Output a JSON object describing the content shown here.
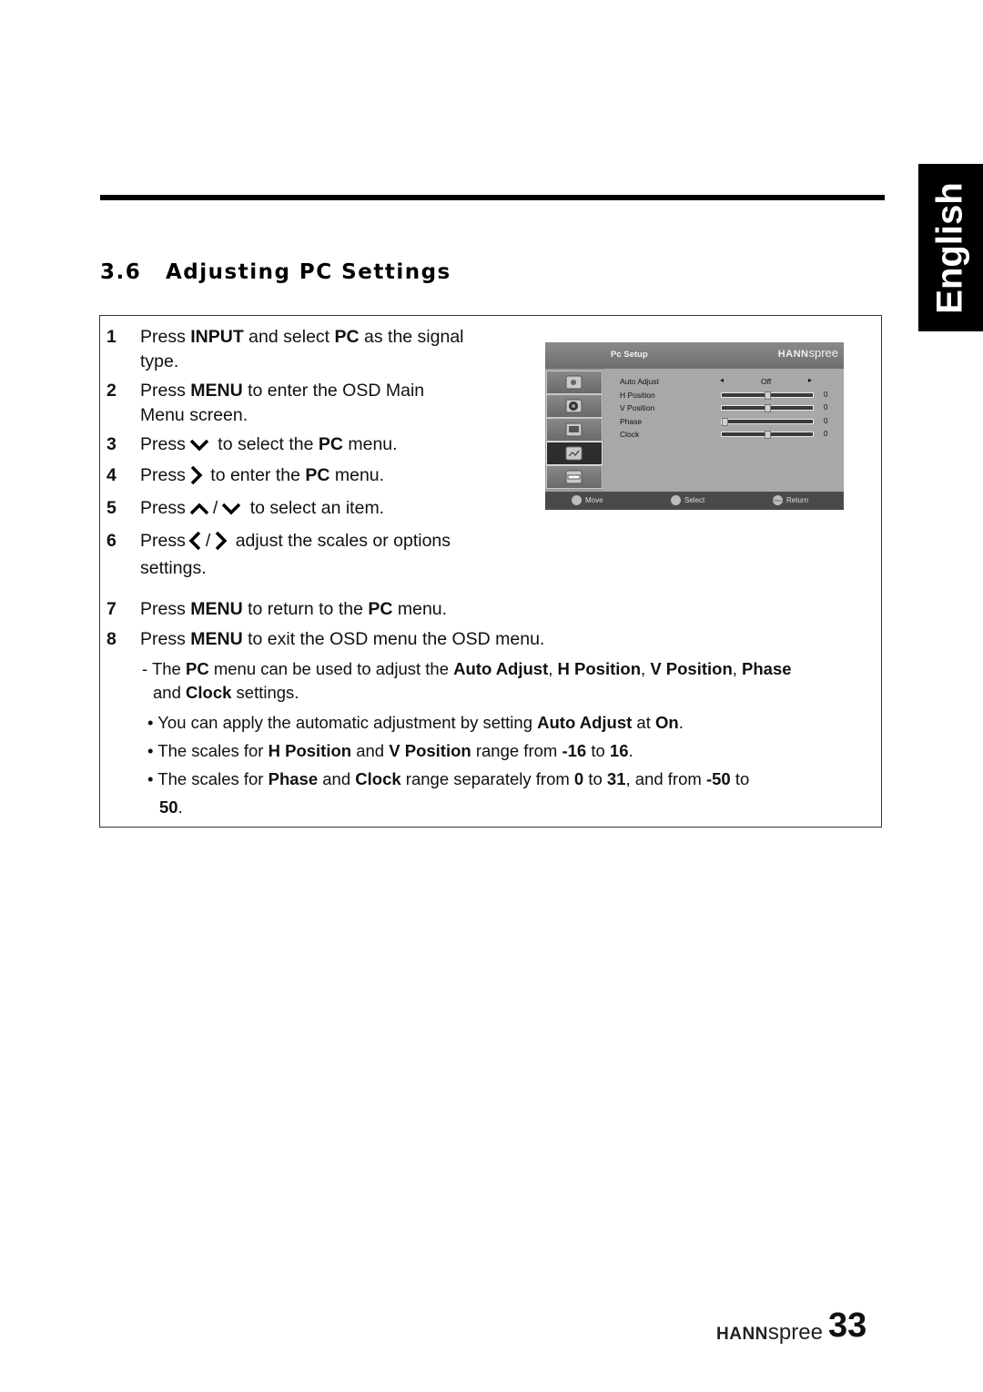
{
  "language_tab": "English",
  "section": {
    "number": "3.6",
    "title": "Adjusting PC Settings"
  },
  "steps": [
    {
      "n": "1",
      "parts": [
        "Press ",
        "INPUT",
        " and select ",
        "PC",
        " as the signal"
      ],
      "line2": "type."
    },
    {
      "n": "2",
      "parts": [
        "Press ",
        "MENU",
        " to enter the OSD Main"
      ],
      "line2": "Menu screen."
    },
    {
      "n": "3",
      "pre": "Press",
      "icon": "down-arrow",
      "post": " to select the ",
      "bold": "PC",
      "end": " menu."
    },
    {
      "n": "4",
      "pre": "Press",
      "icon": "right-arrow",
      "post": " to enter the ",
      "bold": "PC",
      "end": " menu."
    },
    {
      "n": "5",
      "pre": "Press",
      "icon1": "up-arrow",
      "sep": "/",
      "icon2": "down-arrow",
      "post": " to select an item."
    },
    {
      "n": "6",
      "pre": "Press",
      "icon1": "left-arrow",
      "sep": "/",
      "icon2": "right-arrow",
      "post": " adjust the scales or options",
      "line2": "settings."
    },
    {
      "n": "7",
      "parts": [
        "Press ",
        "MENU",
        " to return to the ",
        "PC",
        " menu."
      ]
    },
    {
      "n": "8",
      "parts": [
        "Press ",
        "MENU",
        " to exit the OSD menu the OSD menu."
      ]
    }
  ],
  "notes": {
    "dash": {
      "line1": [
        "- The ",
        "PC",
        " menu can be used to adjust the ",
        "Auto Adjust",
        ", ",
        "H Position",
        ", ",
        "V Position",
        ", ",
        "Phase"
      ],
      "line2": [
        "and ",
        "Clock",
        " settings."
      ]
    },
    "bullets": [
      [
        "• You can apply the automatic adjustment by setting ",
        "Auto Adjust",
        " at ",
        "On",
        "."
      ],
      [
        "• The scales for ",
        "H Position",
        " and ",
        "V Position",
        " range from ",
        "-16",
        " to ",
        "16",
        "."
      ],
      [
        "• The scales for ",
        "Phase",
        " and ",
        "Clock",
        " range separately from ",
        "0",
        " to ",
        "31",
        ", and from ",
        "-50",
        " to"
      ]
    ],
    "bullet3_line2": [
      "50",
      "."
    ]
  },
  "osd": {
    "title": "Pc Setup",
    "brand_bold": "HANN",
    "brand_light": "spree",
    "side_icons": [
      "picture-icon",
      "audio-icon",
      "tv-icon",
      "pc-icon",
      "setup-icon"
    ],
    "active_icon": 3,
    "auto_adjust": {
      "label": "Auto Adjust",
      "value": "Off"
    },
    "sliders": [
      {
        "label": "H Position",
        "value": "0",
        "min": -16,
        "max": 16,
        "v": 0
      },
      {
        "label": "V Position",
        "value": "0",
        "min": -16,
        "max": 16,
        "v": 0
      },
      {
        "label": "Phase",
        "value": "0",
        "min": 0,
        "max": 31,
        "v": 0
      },
      {
        "label": "Clock",
        "value": "0",
        "min": -50,
        "max": 50,
        "v": 0
      }
    ],
    "footer": {
      "move": "Move",
      "select": "Select",
      "menu_badge": "Menu",
      "return": "Return"
    }
  },
  "footer": {
    "brand_bold": "HANN",
    "brand_light": "spree",
    "page_number": "33"
  }
}
